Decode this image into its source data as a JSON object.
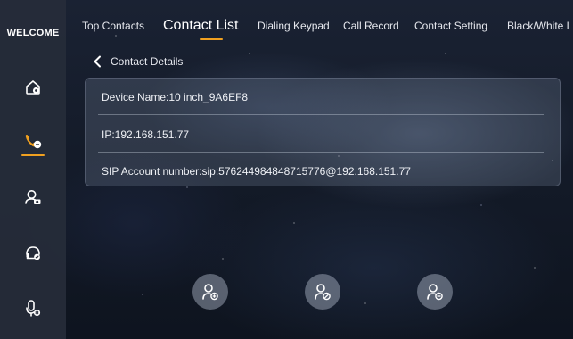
{
  "sidebar": {
    "brand": "WELCOME",
    "items": [
      {
        "icon": "home-icon",
        "active": false
      },
      {
        "icon": "phone-icon",
        "active": true
      },
      {
        "icon": "user-camera-icon",
        "active": false
      },
      {
        "icon": "headset-icon",
        "active": false
      },
      {
        "icon": "mic-icon",
        "active": false
      }
    ]
  },
  "tabs": [
    {
      "label": "Top Contacts",
      "active": false
    },
    {
      "label": "Contact List",
      "active": true
    },
    {
      "label": "Dialing Keypad",
      "active": false
    },
    {
      "label": "Call Record",
      "active": false
    },
    {
      "label": "Contact Setting",
      "active": false
    },
    {
      "label": "Black/White L",
      "active": false
    }
  ],
  "details": {
    "title": "Contact Details",
    "device_name": "Device Name:10 inch_9A6EF8",
    "ip": "IP:192.168.151.77",
    "sip": "SIP Account number:sip:5762449848487157​76@192.168.151.77"
  },
  "actions": [
    {
      "icon": "add-contact-icon"
    },
    {
      "icon": "block-contact-icon"
    },
    {
      "icon": "remove-contact-icon"
    }
  ],
  "colors": {
    "accent": "#f0a020",
    "sidebar": "#262c3a"
  }
}
